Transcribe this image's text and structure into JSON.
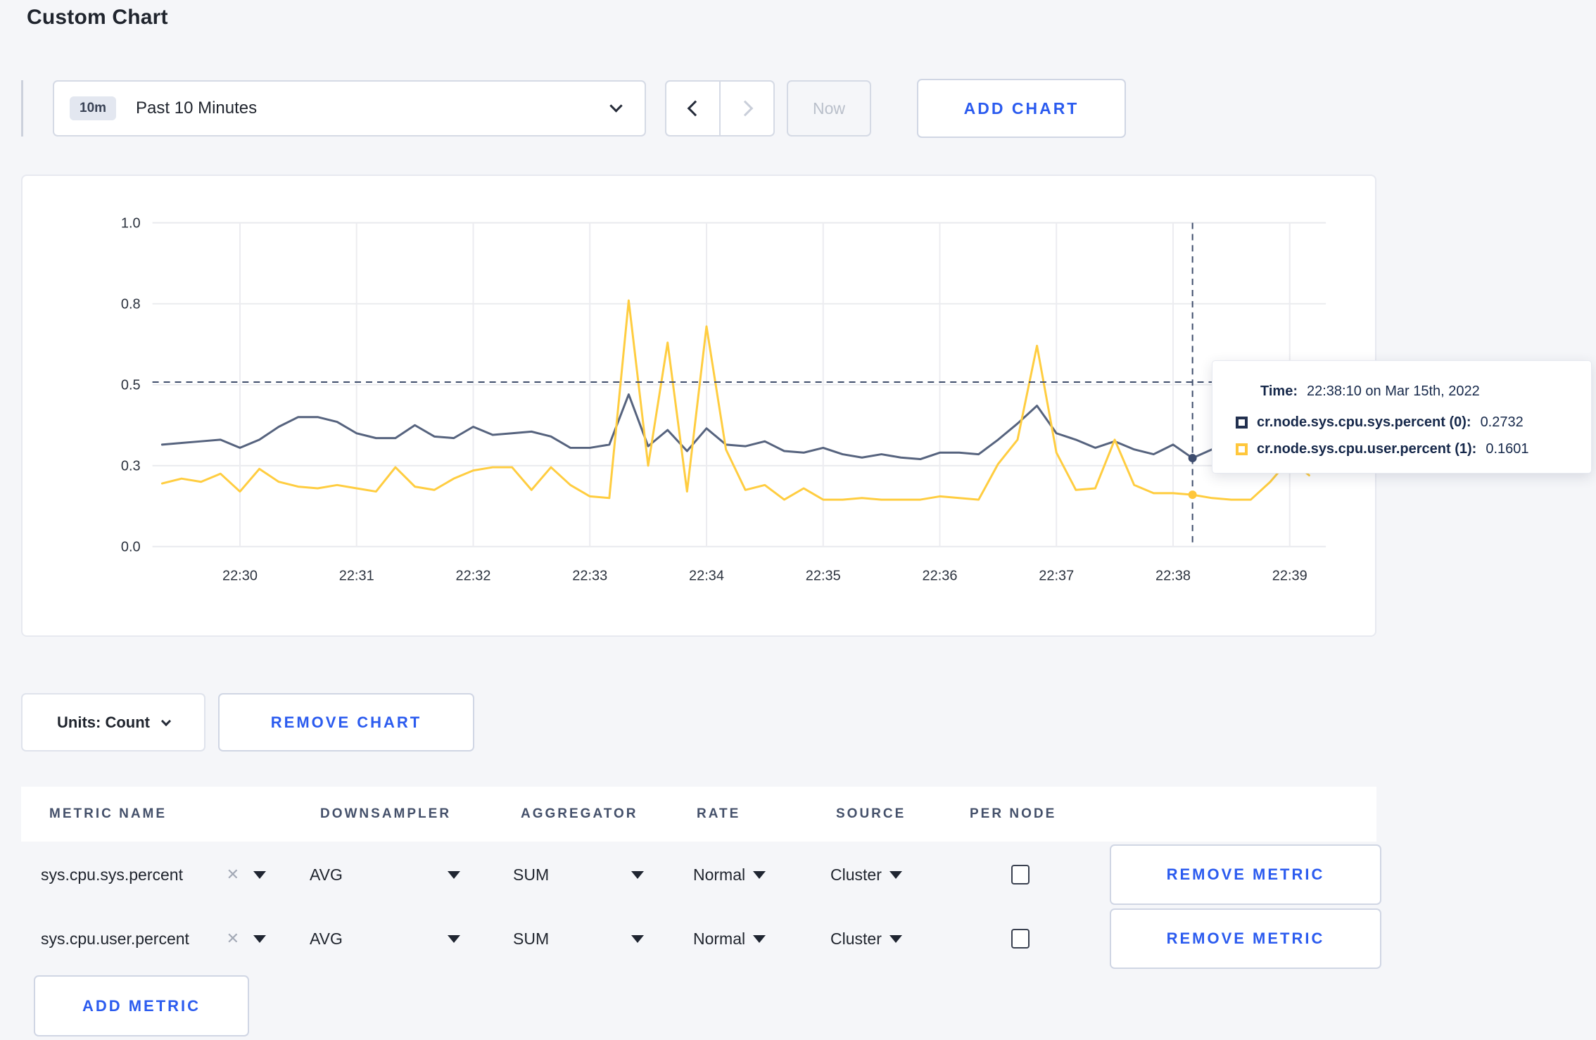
{
  "page": {
    "title": "Custom Chart",
    "background": "#f5f6f9",
    "accent_blue": "#2b5bef"
  },
  "toolbar": {
    "time_window_badge": "10m",
    "time_window_label": "Past 10 Minutes",
    "now_label": "Now",
    "add_chart_label": "ADD CHART"
  },
  "icons": {
    "clear_glyph": "✕"
  },
  "chart_controls": {
    "units_label": "Units: Count",
    "remove_chart_label": "REMOVE CHART"
  },
  "tooltip": {
    "time_label": "Time:",
    "time_value": "22:38:10 on Mar 15th, 2022",
    "series": [
      {
        "label": "cr.node.sys.cpu.sys.percent (0):",
        "value": "0.2732",
        "color": "#22304f"
      },
      {
        "label": "cr.node.sys.cpu.user.percent (1):",
        "value": "0.1601",
        "color": "#ffc73c"
      }
    ]
  },
  "chart_data": {
    "type": "line",
    "title": "",
    "xlabel": "",
    "ylabel": "",
    "ylim": [
      0,
      1
    ],
    "grid": true,
    "legend_position": "none",
    "y_tick_values": [
      0,
      0.25,
      0.5,
      0.75,
      1.0
    ],
    "y_tick_labels": [
      "0.0",
      "0.3",
      "0.5",
      "0.8",
      "1.0"
    ],
    "x_ticks": [
      "22:30",
      "22:31",
      "22:32",
      "22:33",
      "22:34",
      "22:35",
      "22:36",
      "22:37",
      "22:38",
      "22:39"
    ],
    "domain_start": "22:29:15",
    "domain_end": "22:39:15",
    "domain_seconds": 600,
    "first_offset_seconds": 5,
    "interval_seconds": 10,
    "series": [
      {
        "name": "cr.node.sys.cpu.sys.percent",
        "color": "#56637e",
        "values": [
          0.315,
          0.32,
          0.325,
          0.33,
          0.305,
          0.33,
          0.37,
          0.4,
          0.4,
          0.385,
          0.35,
          0.335,
          0.335,
          0.375,
          0.34,
          0.335,
          0.37,
          0.345,
          0.35,
          0.355,
          0.34,
          0.305,
          0.305,
          0.315,
          0.47,
          0.31,
          0.36,
          0.295,
          0.365,
          0.315,
          0.31,
          0.325,
          0.295,
          0.29,
          0.305,
          0.285,
          0.275,
          0.285,
          0.275,
          0.27,
          0.29,
          0.29,
          0.285,
          0.33,
          0.38,
          0.435,
          0.35,
          0.33,
          0.305,
          0.325,
          0.3,
          0.285,
          0.315,
          0.2732,
          0.3,
          0.31,
          0.295,
          0.3,
          0.305,
          0.3
        ]
      },
      {
        "name": "cr.node.sys.cpu.user.percent",
        "color": "#ffcd40",
        "values": [
          0.195,
          0.21,
          0.2,
          0.225,
          0.17,
          0.24,
          0.2,
          0.185,
          0.18,
          0.19,
          0.18,
          0.17,
          0.245,
          0.185,
          0.175,
          0.21,
          0.235,
          0.245,
          0.245,
          0.175,
          0.245,
          0.19,
          0.155,
          0.15,
          0.76,
          0.25,
          0.63,
          0.17,
          0.68,
          0.3,
          0.175,
          0.19,
          0.145,
          0.18,
          0.145,
          0.145,
          0.15,
          0.145,
          0.145,
          0.145,
          0.155,
          0.15,
          0.145,
          0.255,
          0.33,
          0.62,
          0.29,
          0.175,
          0.18,
          0.33,
          0.19,
          0.165,
          0.165,
          0.1601,
          0.15,
          0.145,
          0.145,
          0.2,
          0.27,
          0.22
        ]
      }
    ],
    "hover": {
      "time": "22:38:10",
      "offset_seconds": 535,
      "y_value": 0.508,
      "crosshair_color": "#3e4d6b",
      "points": [
        {
          "series": "cr.node.sys.cpu.sys.percent",
          "value": 0.2732,
          "color": "#3d4c6e"
        },
        {
          "series": "cr.node.sys.cpu.user.percent",
          "value": 0.1601,
          "color": "#ffc73c"
        }
      ]
    }
  },
  "metrics_table": {
    "headers": [
      "METRIC NAME",
      "DOWNSAMPLER",
      "AGGREGATOR",
      "RATE",
      "SOURCE",
      "PER NODE"
    ],
    "rows": [
      {
        "metric": "sys.cpu.sys.percent",
        "downsampler": "AVG",
        "aggregator": "SUM",
        "rate": "Normal",
        "source": "Cluster",
        "per_node_checked": false,
        "remove_label": "REMOVE METRIC"
      },
      {
        "metric": "sys.cpu.user.percent",
        "downsampler": "AVG",
        "aggregator": "SUM",
        "rate": "Normal",
        "source": "Cluster",
        "per_node_checked": false,
        "remove_label": "REMOVE METRIC"
      }
    ],
    "add_metric_label": "ADD METRIC"
  }
}
